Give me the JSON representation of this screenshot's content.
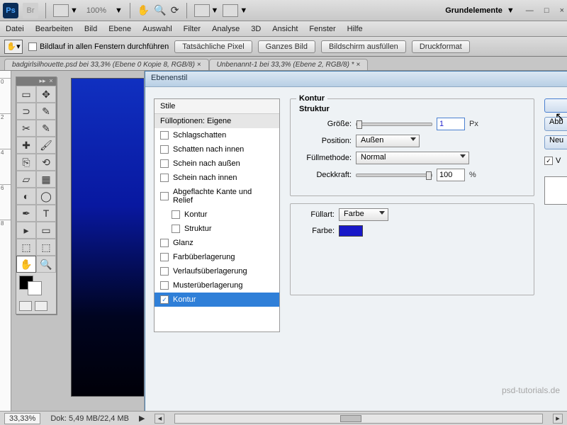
{
  "app": {
    "logo": "Ps",
    "bridge": "Br",
    "zoom": "100%",
    "workspace": "Grundelemente"
  },
  "menu": [
    "Datei",
    "Bearbeiten",
    "Bild",
    "Ebene",
    "Auswahl",
    "Filter",
    "Analyse",
    "3D",
    "Ansicht",
    "Fenster",
    "Hilfe"
  ],
  "options": {
    "scroll_all": "Bildlauf in allen Fenstern durchführen",
    "btns": [
      "Tatsächliche Pixel",
      "Ganzes Bild",
      "Bildschirm ausfüllen",
      "Druckformat"
    ]
  },
  "tabs": [
    "badgirlsilhouette.psd bei 33,3% (Ebene 0 Kopie 8, RGB/8) ×",
    "Unbenannt-1 bei 33,3% (Ebene 2, RGB/8) * ×"
  ],
  "dialog": {
    "title": "Ebenenstil",
    "styles_header": "Stile",
    "fill_opts": "Fülloptionen: Eigene",
    "rows": [
      {
        "label": "Schlagschatten"
      },
      {
        "label": "Schatten nach innen"
      },
      {
        "label": "Schein nach außen"
      },
      {
        "label": "Schein nach innen"
      },
      {
        "label": "Abgeflachte Kante und Relief"
      },
      {
        "label": "Kontur",
        "sub": true
      },
      {
        "label": "Struktur",
        "sub": true
      },
      {
        "label": "Glanz"
      },
      {
        "label": "Farbüberlagerung"
      },
      {
        "label": "Verlaufsüberlagerung"
      },
      {
        "label": "Musterüberlagerung"
      },
      {
        "label": "Kontur",
        "sel": true
      }
    ],
    "panel": {
      "title": "Kontur",
      "struct": "Struktur",
      "size_label": "Größe:",
      "size_value": "1",
      "size_unit": "Px",
      "pos_label": "Position:",
      "pos_value": "Außen",
      "fill_label": "Füllmethode:",
      "fill_value": "Normal",
      "opacity_label": "Deckkraft:",
      "opacity_value": "100",
      "opacity_unit": "%",
      "fillart_label": "Füllart:",
      "fillart_value": "Farbe",
      "color_label": "Farbe:",
      "color": "#1818c8"
    },
    "buttons": {
      "ok": "",
      "cancel": "Abb",
      "new": "Neu",
      "preview": "V"
    }
  },
  "status": {
    "zoom": "33,33%",
    "doc": "Dok: 5,49 MB/22,4 MB"
  },
  "watermark": "psd-tutorials.de"
}
